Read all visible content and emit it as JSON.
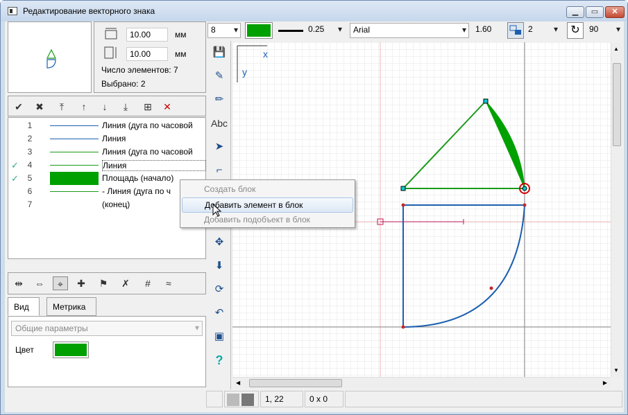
{
  "window": {
    "title": "Редактирование векторного знака",
    "min": "▁",
    "max": "▭",
    "close": "✕"
  },
  "dimensions": {
    "width_value": "10.00",
    "height_value": "10.00",
    "unit": "мм"
  },
  "info": {
    "elements": "Число элементов: 7",
    "selected": "Выбрано: 2"
  },
  "list_rows": [
    {
      "num": "1",
      "checked": false,
      "swatch": "line",
      "color": "#1c5fb0",
      "label": "Линия (дуга по часовой"
    },
    {
      "num": "2",
      "checked": false,
      "swatch": "line",
      "color": "#1c5fb0",
      "label": "Линия"
    },
    {
      "num": "3",
      "checked": false,
      "swatch": "line",
      "color": "#1a9a1a",
      "label": "Линия (дуга по часовой"
    },
    {
      "num": "4",
      "checked": true,
      "swatch": "line",
      "color": "#1a9a1a",
      "label": "Линия"
    },
    {
      "num": "5",
      "checked": true,
      "swatch": "fill",
      "color": "#00a000",
      "label": "Площадь (начало)"
    },
    {
      "num": "6",
      "checked": false,
      "swatch": "line",
      "color": "#1a9a1a",
      "label": "- Линия (дуга по ч"
    },
    {
      "num": "7",
      "checked": false,
      "swatch": "none",
      "color": "",
      "label": "(конец)"
    }
  ],
  "check_mark": "✓",
  "tabs": {
    "view": "Вид",
    "metric": "Метрика"
  },
  "params": {
    "combo": "Общие параметры",
    "color_label": "Цвет"
  },
  "toolbar": {
    "size": "8",
    "line_width": "0.25",
    "font": "Arial",
    "font_size": "1.60",
    "layer": "2",
    "angle": "90"
  },
  "canvas": {
    "x_axis": "x",
    "y_axis": "y"
  },
  "status": {
    "coords": "1, 22",
    "selection_size": "0 x 0"
  },
  "context_menu": {
    "create_block": "Создать блок",
    "add_to_block": "Добавить элемент в блок",
    "add_subobject": "Добавить подобъект в блок"
  },
  "left_tools_help": "?",
  "colors": {
    "accent_green": "#00a000",
    "line_blue": "#1c5fb0",
    "selection_red": "#cc0000"
  }
}
